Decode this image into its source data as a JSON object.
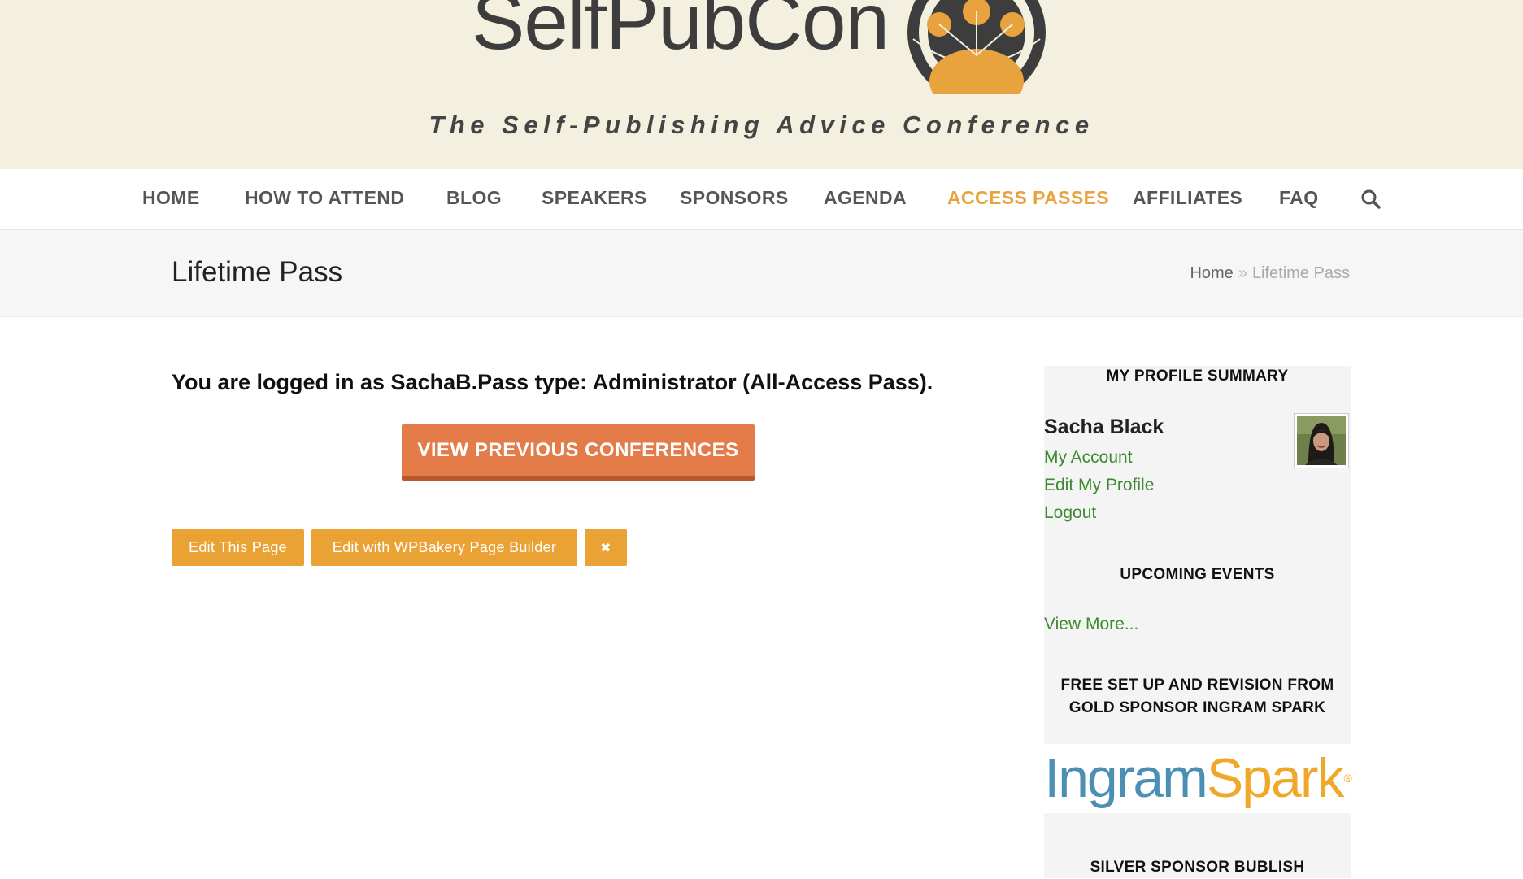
{
  "header": {
    "logo_text": "SelfPubCon",
    "tagline": "The Self-Publishing Advice Conference"
  },
  "nav": {
    "items": [
      {
        "label": "HOME"
      },
      {
        "label": "HOW TO ATTEND"
      },
      {
        "label": "BLOG"
      },
      {
        "label": "SPEAKERS"
      },
      {
        "label": "SPONSORS"
      },
      {
        "label": "AGENDA"
      },
      {
        "label": "ACCESS PASSES",
        "active": true
      },
      {
        "label": "AFFILIATES"
      },
      {
        "label": "FAQ"
      }
    ],
    "search_icon": "search-icon",
    "active_color": "#e8a23e"
  },
  "title_bar": {
    "title": "Lifetime Pass",
    "breadcrumb": {
      "home": "Home",
      "separator": "»",
      "current": "Lifetime Pass"
    }
  },
  "main": {
    "login_message": "You are logged in as SachaB.Pass type: Administrator (All-Access Pass).",
    "previous_button": "VIEW PREVIOUS CONFERENCES",
    "admin_buttons": {
      "edit_page": "Edit This Page",
      "edit_wpbakery": "Edit with WPBakery Page Builder",
      "close_glyph": "✖"
    }
  },
  "sidebar": {
    "profile": {
      "title": "MY PROFILE SUMMARY",
      "name": "Sacha Black",
      "links": [
        "My Account",
        "Edit My Profile",
        "Logout"
      ]
    },
    "events": {
      "title": "UPCOMING EVENTS",
      "view_more": "View More..."
    },
    "sponsor_gold": {
      "title_line1": "FREE SET UP AND REVISION FROM",
      "title_line2": "GOLD SPONSOR INGRAM SPARK",
      "logo_part1": "Ingram",
      "logo_part2": "Spark",
      "logo_mark": "®"
    },
    "sponsor_silver": {
      "title": "SILVER SPONSOR BUBLISH"
    }
  },
  "colors": {
    "header_bg": "#f4f0df",
    "accent_orange": "#e37c48",
    "admin_button": "#eba235",
    "link_green": "#3c8a2e"
  }
}
